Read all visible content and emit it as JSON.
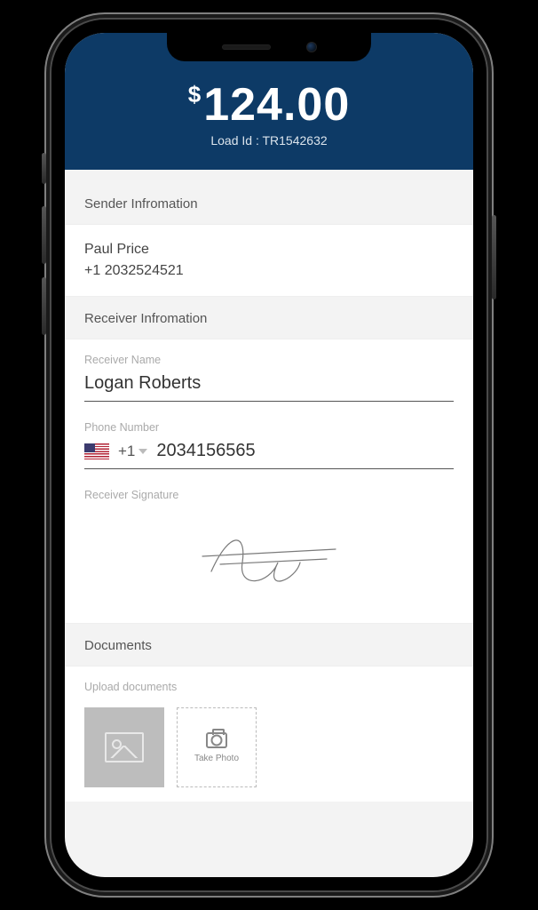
{
  "header": {
    "currency_symbol": "$",
    "amount": "124.00",
    "load_id_label": "Load Id : ",
    "load_id_value": "TR1542632"
  },
  "sender": {
    "section_title": "Sender Infromation",
    "name": "Paul Price",
    "phone": "+1 2032524521"
  },
  "receiver": {
    "section_title": "Receiver Infromation",
    "name_label": "Receiver Name",
    "name_value": "Logan Roberts",
    "phone_label": "Phone Number",
    "country_code": "+1",
    "phone_value": "2034156565",
    "signature_label": "Receiver Signature"
  },
  "documents": {
    "section_title": "Documents",
    "upload_label": "Upload documents",
    "take_photo_label": "Take Photo"
  },
  "colors": {
    "header_bg": "#0d3a66",
    "body_bg": "#f3f3f3"
  }
}
